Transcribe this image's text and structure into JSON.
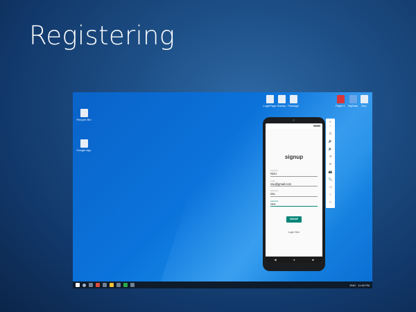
{
  "slide": {
    "title": "Registering"
  },
  "desktop": {
    "icons_left": [
      {
        "name": "recycle-bin-icon",
        "label": "Recycle Bin"
      },
      {
        "name": "desktop-file-icon",
        "label": "Google App"
      }
    ],
    "icons_top": [
      {
        "name": "file-icon",
        "label": "LoginPage",
        "color": "#e8eef6"
      },
      {
        "name": "file-icon",
        "label": "Startup",
        "color": "#e8eef6"
      },
      {
        "name": "file-icon",
        "label": "Package",
        "color": "#e8eef6"
      },
      {
        "name": "pdf-icon",
        "label": "Paper.1",
        "color": "#d9363a"
      },
      {
        "name": "file-icon",
        "label": "MyData",
        "color": "#6aa6e8"
      },
      {
        "name": "file-icon",
        "label": "Doc",
        "color": "#e8eef6"
      }
    ]
  },
  "taskbar": {
    "tray_text": "ENG",
    "clock": "11:46 PM"
  },
  "phone": {
    "app_title": "signup",
    "fields": [
      {
        "label": "Fullname",
        "value": "NSU",
        "active": false
      },
      {
        "label": "email",
        "value": "nsu@gmail.com",
        "active": false
      },
      {
        "label": "username",
        "value": "nsu",
        "active": false
      },
      {
        "label": "password",
        "value": "•••••",
        "active": true
      }
    ],
    "signup_button": "SIGNUP",
    "login_link": "Login Here",
    "nav": {
      "back": "◀",
      "home": "●",
      "recents": "■"
    }
  },
  "emulator_panel": {
    "close": "×",
    "minimize": "–",
    "buttons": [
      "⏻",
      "🔊",
      "🔈",
      "⟲",
      "⟳",
      "📷",
      "🔍",
      "◁",
      "○",
      "□",
      "⋯"
    ]
  }
}
